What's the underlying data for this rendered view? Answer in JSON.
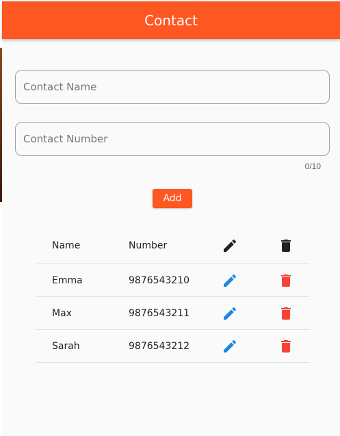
{
  "appbar": {
    "title": "Contact",
    "color": "#ff5722"
  },
  "form": {
    "name_placeholder": "Contact Name",
    "name_value": "",
    "number_placeholder": "Contact Number",
    "number_value": "",
    "number_counter": "0/10",
    "add_label": "Add"
  },
  "table": {
    "headers": {
      "name": "Name",
      "number": "Number",
      "edit_icon": "pencil-icon",
      "delete_icon": "trash-icon"
    },
    "rows": [
      {
        "name": "Emma",
        "number": "9876543210"
      },
      {
        "name": "Max",
        "number": "9876543211"
      },
      {
        "name": "Sarah",
        "number": "9876543212"
      }
    ]
  },
  "colors": {
    "accent": "#ff5722",
    "edit_icon": "#1e88e5",
    "delete_icon": "#f44336",
    "header_icon": "#212121"
  }
}
